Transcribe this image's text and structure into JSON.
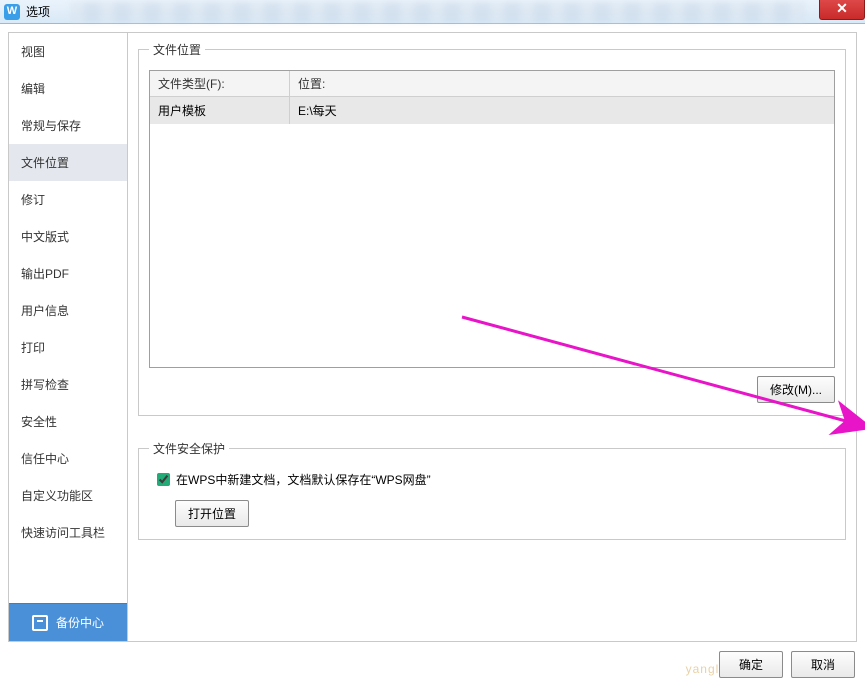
{
  "titlebar": {
    "title": "选项"
  },
  "sidebar": {
    "items": [
      {
        "label": "视图"
      },
      {
        "label": "编辑"
      },
      {
        "label": "常规与保存"
      },
      {
        "label": "文件位置",
        "selected": true
      },
      {
        "label": "修订"
      },
      {
        "label": "中文版式"
      },
      {
        "label": "输出PDF"
      },
      {
        "label": "用户信息"
      },
      {
        "label": "打印"
      },
      {
        "label": "拼写检查"
      },
      {
        "label": "安全性"
      },
      {
        "label": "信任中心"
      },
      {
        "label": "自定义功能区"
      },
      {
        "label": "快速访问工具栏"
      }
    ],
    "backup_label": "备份中心"
  },
  "file_location": {
    "legend": "文件位置",
    "col_type": "文件类型(F):",
    "col_loc": "位置:",
    "rows": [
      {
        "type": "用户模板",
        "location": "E:\\每天",
        "selected": true
      }
    ],
    "modify_label": "修改(M)..."
  },
  "file_safety": {
    "legend": "文件安全保护",
    "checkbox_label": "在WPS中新建文档，文档默认保存在“WPS网盘”",
    "checked": true,
    "open_label": "打开位置"
  },
  "footer": {
    "ok": "确定",
    "cancel": "取消"
  },
  "watermark_text": "yanglaida.co"
}
